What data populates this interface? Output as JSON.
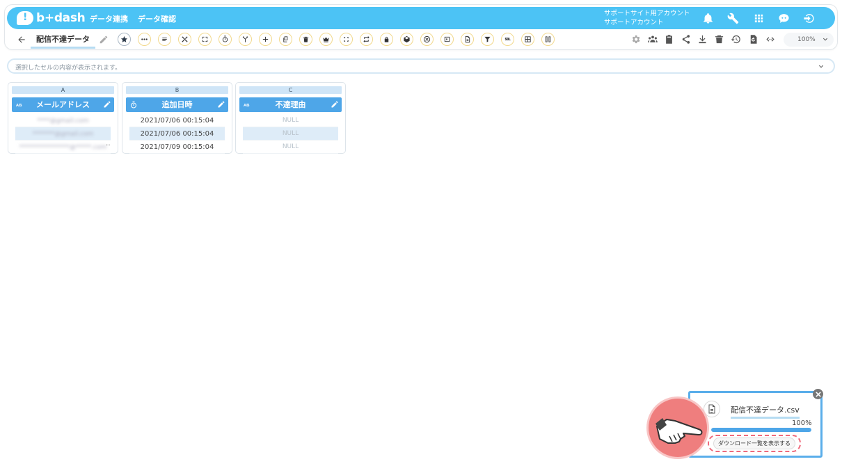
{
  "nav": {
    "logo_text": "b+dash",
    "links": [
      "データ連携",
      "データ確認"
    ],
    "account_line1": "サポートサイト用アカウント",
    "account_line2": "サポートアカウント",
    "brand_color": "#4cc3f5"
  },
  "toolbar": {
    "dataset_name": "配信不達データ",
    "zoom": "100%"
  },
  "cellbar": {
    "placeholder": "選択したセルの内容が表示されます。"
  },
  "columns": [
    {
      "letter": "A",
      "name": "メールアドレス",
      "type_icon": "text-type-icon",
      "cells": [
        "****@gmail.com",
        "*******@gmail.com",
        "****************@*****.com"
      ],
      "ellipsis": "…"
    },
    {
      "letter": "B",
      "name": "追加日時",
      "type_icon": "datetime-type-icon",
      "cells": [
        "2021/07/06 00:15:04",
        "2021/07/06 00:15:04",
        "2021/07/09 00:15:04"
      ]
    },
    {
      "letter": "C",
      "name": "不達理由",
      "type_icon": "text-type-icon",
      "cells": [
        "NULL",
        "NULL",
        "NULL"
      ]
    }
  ],
  "download": {
    "file_name": "配信不達データ.csv",
    "progress_label": "100%",
    "progress": 1.0,
    "show_list_button": "ダウンロード一覧を表示する"
  }
}
